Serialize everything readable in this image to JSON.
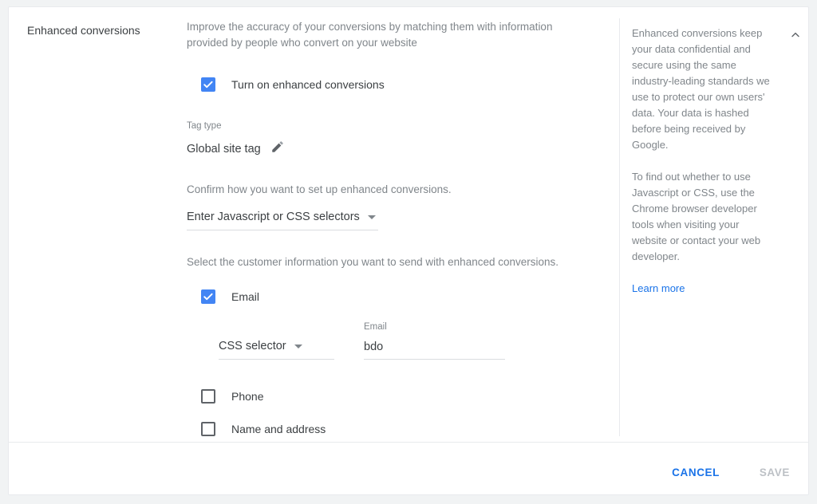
{
  "card": {
    "section_title": "Enhanced conversions",
    "description": "Improve the accuracy of your conversions by matching them with information provided by people who convert on your website",
    "enable": {
      "label": "Turn on enhanced conversions",
      "checked": true,
      "icon": "checkbox-checked-icon"
    },
    "tag_type": {
      "label": "Tag type",
      "value": "Global site tag",
      "edit_icon": "pencil-icon"
    },
    "setup": {
      "prompt": "Confirm how you want to set up enhanced conversions.",
      "selected": "Enter Javascript or CSS selectors",
      "caret_icon": "chevron-down-icon"
    },
    "customer_info": {
      "prompt": "Select the customer information you want to send with enhanced conversions.",
      "items": [
        {
          "label": "Email",
          "checked": true
        },
        {
          "label": "Phone",
          "checked": false
        },
        {
          "label": "Name and address",
          "checked": false
        }
      ]
    },
    "email_row": {
      "selector_type": "CSS selector",
      "selector_caret_icon": "chevron-down-icon",
      "field_label": "Email",
      "field_value": "bdo",
      "field_placeholder": "Email"
    }
  },
  "help": {
    "paragraphs": [
      "Enhanced conversions keep your data confidential and secure using the same industry-leading standards we use to protect our own users' data. Your data is hashed before being received by Google.",
      "To find out whether to use Javascript or CSS, use the Chrome browser developer tools when visiting your website or contact your web developer."
    ],
    "link_label": "Learn more",
    "collapse_icon": "chevron-up-icon"
  },
  "footer": {
    "cancel_label": "CANCEL",
    "save_label": "SAVE"
  },
  "colors": {
    "accent_blue": "#4285f4",
    "link_blue": "#1a73e8",
    "text_primary": "#3c4043",
    "text_secondary": "#80868b",
    "disabled": "#bdc1c6",
    "divider": "#e8eaed",
    "page_bg": "#f1f3f4"
  }
}
